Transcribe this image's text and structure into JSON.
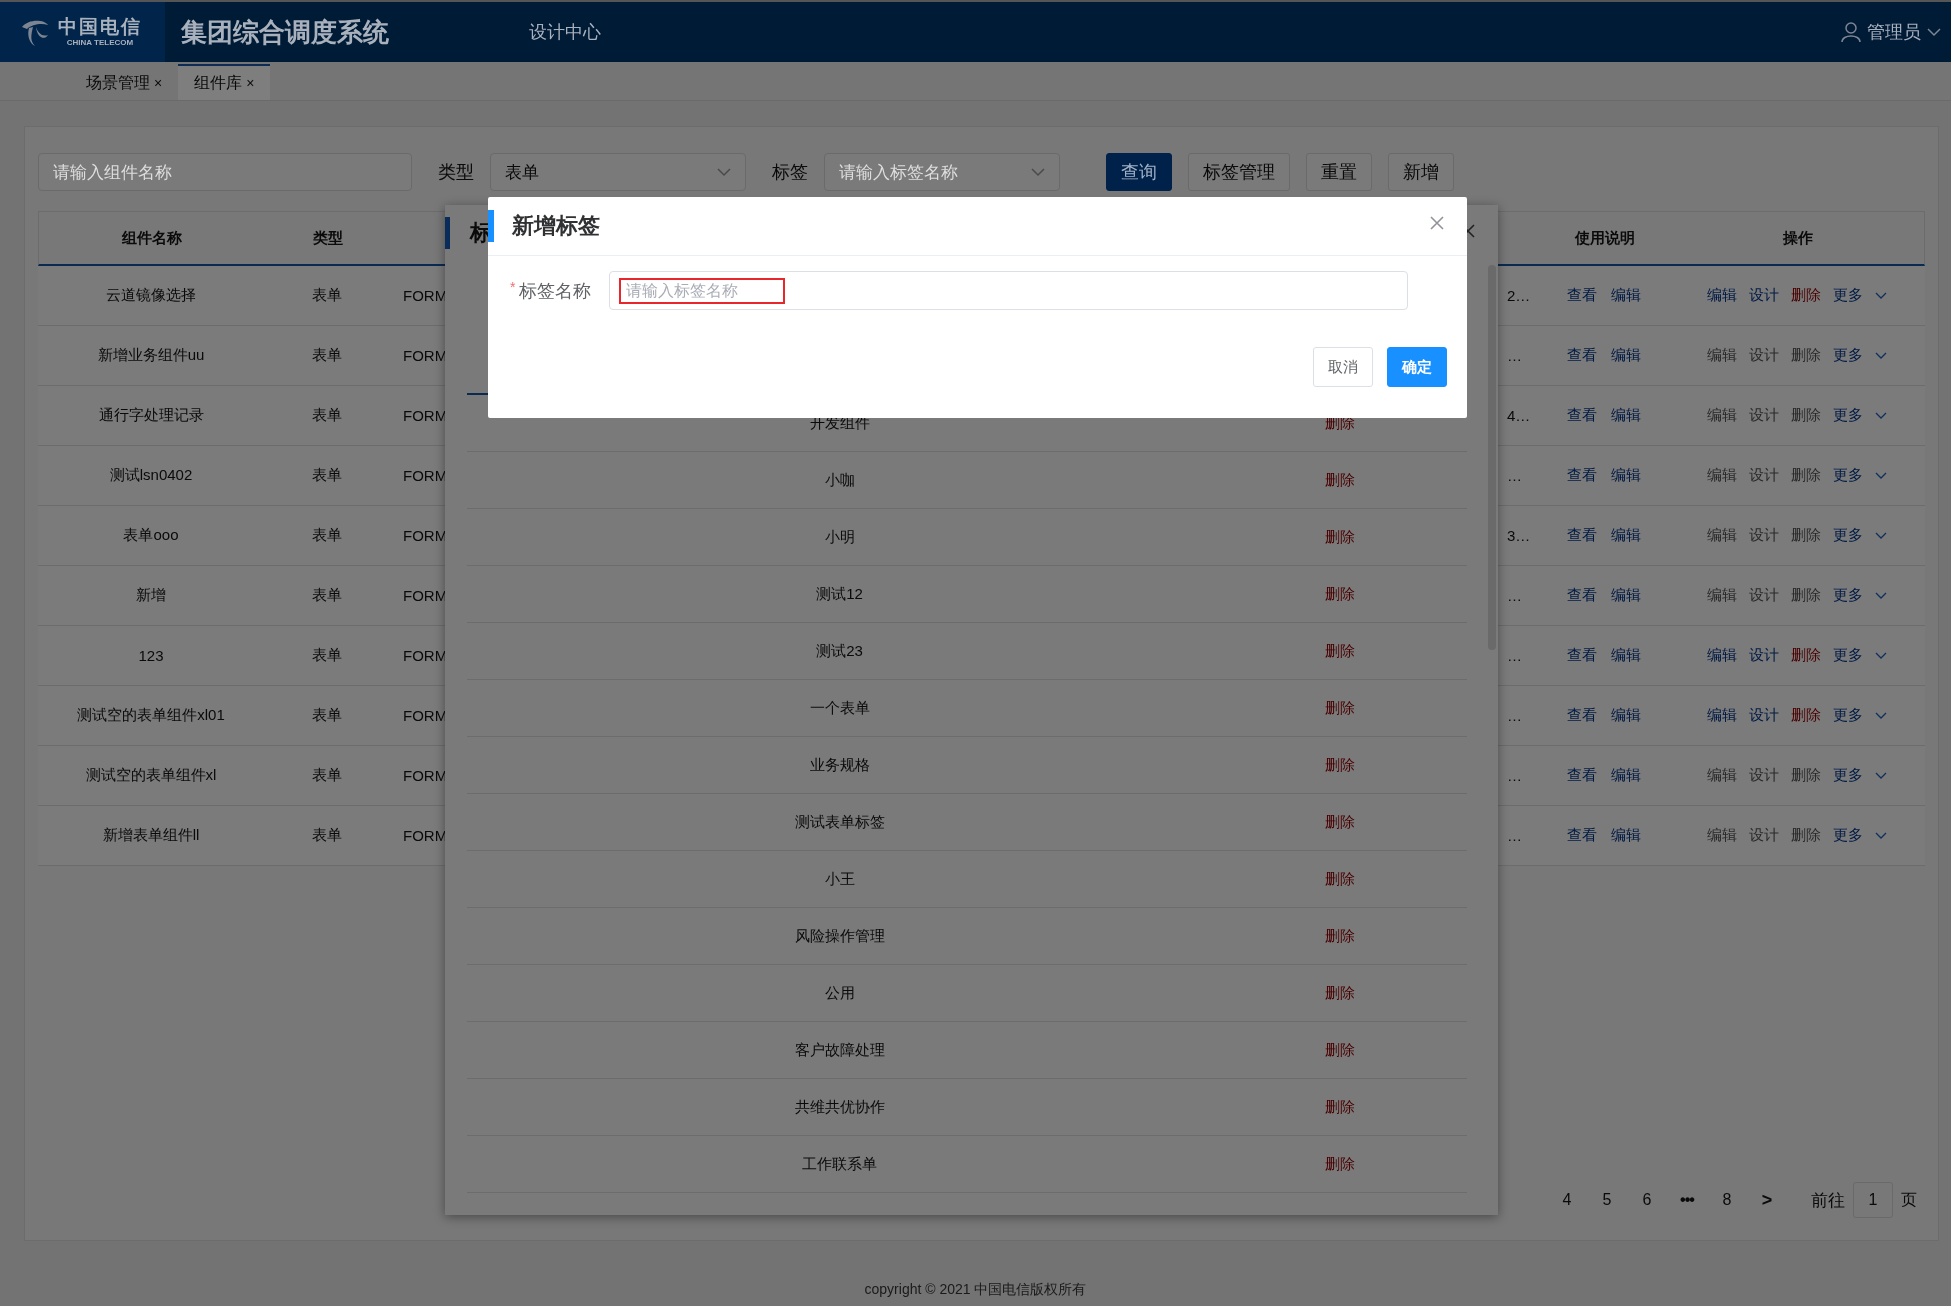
{
  "header": {
    "logo_cn": "中国电信",
    "logo_en": "CHINA TELECOM",
    "title": "集团综合调度系统",
    "nav": [
      {
        "label": "设计中心"
      }
    ],
    "user": "管理员"
  },
  "tabs": [
    {
      "label": "场景管理",
      "close": "×",
      "selected": false
    },
    {
      "label": "组件库",
      "close": "×",
      "selected": true
    }
  ],
  "filters": {
    "name_placeholder": "请输入组件名称",
    "type_label": "类型",
    "type_value": "表单",
    "tag_label": "标签",
    "tag_placeholder": "请输入标签名称",
    "buttons": [
      {
        "label": "查询",
        "kind": "primary"
      },
      {
        "label": "标签管理",
        "kind": "default"
      },
      {
        "label": "重置",
        "kind": "default"
      },
      {
        "label": "新增",
        "kind": "default"
      }
    ]
  },
  "table": {
    "columns": [
      "组件名称",
      "类型",
      "使用说明",
      "操作"
    ],
    "rows": [
      {
        "name": "云道镜像选择",
        "type": "表单",
        "code": "FORM",
        "column_4": "2…",
        "links": [
          "查看",
          "编辑"
        ],
        "ops": [
          "编辑",
          "设计",
          "删除",
          "更多"
        ],
        "enabled": true
      },
      {
        "name": "新增业务组件uu",
        "type": "表单",
        "code": "FORM",
        "column_4": "…",
        "links": [
          "查看",
          "编辑"
        ],
        "ops": [
          "编辑",
          "设计",
          "删除",
          "更多"
        ],
        "enabled": false
      },
      {
        "name": "通行字处理记录",
        "type": "表单",
        "code": "FORM",
        "column_4": "4…",
        "links": [
          "查看",
          "编辑"
        ],
        "ops": [
          "编辑",
          "设计",
          "删除",
          "更多"
        ],
        "enabled": false
      },
      {
        "name": "测试lsn0402",
        "type": "表单",
        "code": "FORM",
        "column_4": "…",
        "links": [
          "查看",
          "编辑"
        ],
        "ops": [
          "编辑",
          "设计",
          "删除",
          "更多"
        ],
        "enabled": false
      },
      {
        "name": "表单ooo",
        "type": "表单",
        "code": "FORM",
        "column_4": "3…",
        "links": [
          "查看",
          "编辑"
        ],
        "ops": [
          "编辑",
          "设计",
          "删除",
          "更多"
        ],
        "enabled": false
      },
      {
        "name": "新增",
        "type": "表单",
        "code": "FORM",
        "column_4": "…",
        "links": [
          "查看",
          "编辑"
        ],
        "ops": [
          "编辑",
          "设计",
          "删除",
          "更多"
        ],
        "enabled": false
      },
      {
        "name": "123",
        "type": "表单",
        "code": "FORM",
        "column_4": "…",
        "links": [
          "查看",
          "编辑"
        ],
        "ops": [
          "编辑",
          "设计",
          "删除",
          "更多"
        ],
        "enabled": true
      },
      {
        "name": "测试空的表单组件xl01",
        "type": "表单",
        "code": "FORM",
        "column_4": "…",
        "links": [
          "查看",
          "编辑"
        ],
        "ops": [
          "编辑",
          "设计",
          "删除",
          "更多"
        ],
        "enabled": true
      },
      {
        "name": "测试空的表单组件xl",
        "type": "表单",
        "code": "FORM",
        "column_4": "…",
        "links": [
          "查看",
          "编辑"
        ],
        "ops": [
          "编辑",
          "设计",
          "删除",
          "更多"
        ],
        "enabled": false
      },
      {
        "name": "新增表单组件ll",
        "type": "表单",
        "code": "FORM",
        "column_4": "…",
        "links": [
          "查看",
          "编辑"
        ],
        "ops": [
          "编辑",
          "设计",
          "删除",
          "更多"
        ],
        "enabled": false
      }
    ]
  },
  "pagination": {
    "pages": [
      {
        "label": "4",
        "kind": "page"
      },
      {
        "label": "5",
        "kind": "page"
      },
      {
        "label": "6",
        "kind": "page"
      },
      {
        "label": "•••",
        "kind": "more"
      },
      {
        "label": "8",
        "kind": "page"
      },
      {
        "label": ">",
        "kind": "next"
      }
    ],
    "goto_label": "前往",
    "goto_value": "1",
    "goto_suffix": "页"
  },
  "footer": "copyright © 2021 中国电信版权所有",
  "tag_dialog": {
    "title": "标",
    "rows": [
      {
        "name": "开发组件",
        "action": "删除"
      },
      {
        "name": "小咖",
        "action": "删除"
      },
      {
        "name": "小明",
        "action": "删除"
      },
      {
        "name": "测试12",
        "action": "删除"
      },
      {
        "name": "测试23",
        "action": "删除"
      },
      {
        "name": "一个表单",
        "action": "删除"
      },
      {
        "name": "业务规格",
        "action": "删除"
      },
      {
        "name": "测试表单标签",
        "action": "删除"
      },
      {
        "name": "小王",
        "action": "删除"
      },
      {
        "name": "风险操作管理",
        "action": "删除"
      },
      {
        "name": "公用",
        "action": "删除"
      },
      {
        "name": "客户故障处理",
        "action": "删除"
      },
      {
        "name": "共维共优协作",
        "action": "删除"
      },
      {
        "name": "工作联系单",
        "action": "删除"
      }
    ]
  },
  "modal": {
    "title": "新增标签",
    "field": {
      "label": "标签名称",
      "required": true,
      "required_mark": "*",
      "placeholder": "请输入标签名称",
      "highlighted": true
    },
    "buttons": [
      {
        "label": "取消",
        "kind": "default"
      },
      {
        "label": "确定",
        "kind": "primary"
      }
    ]
  }
}
